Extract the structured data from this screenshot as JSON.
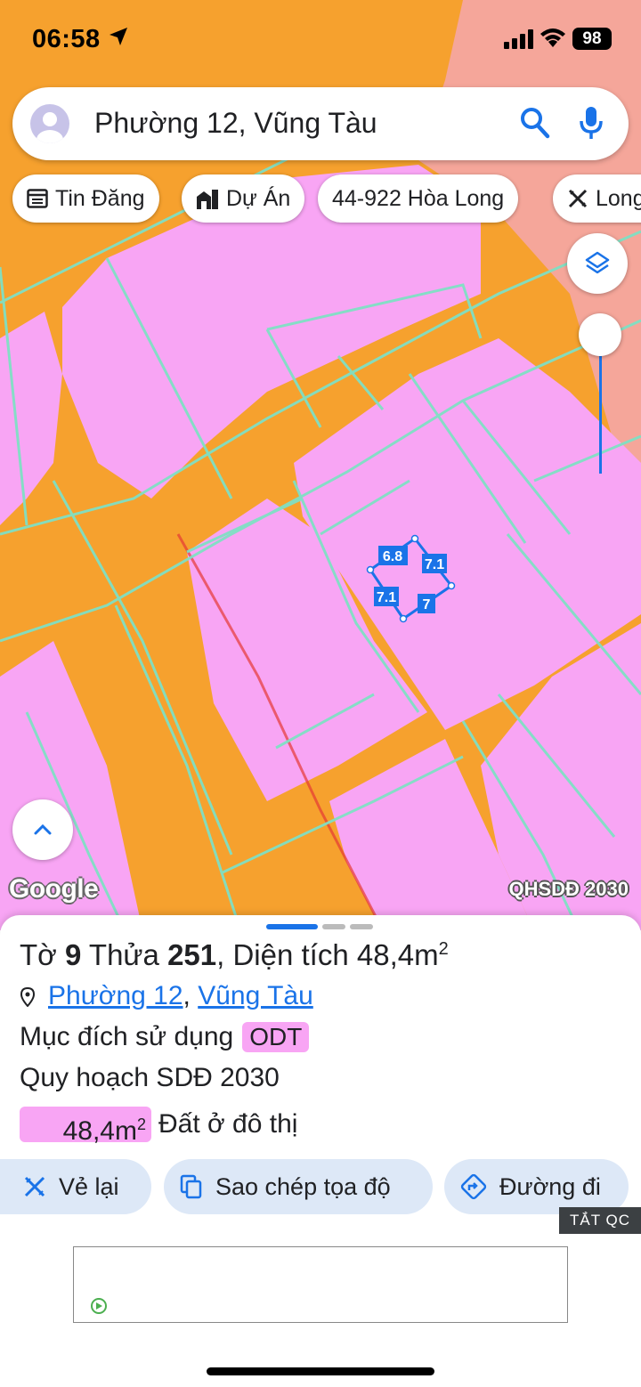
{
  "status": {
    "time": "06:58",
    "battery": "98"
  },
  "search": {
    "text": "Phường 12, Vũng Tàu"
  },
  "chips": [
    {
      "label": "Tin Đăng",
      "icon": "calendar-list-icon"
    },
    {
      "label": "Dự Án",
      "icon": "buildings-icon"
    },
    {
      "label": "44-922 Hòa Long",
      "icon": ""
    },
    {
      "label": "Long",
      "icon": "ruler-pencil-icon"
    }
  ],
  "map": {
    "logo": "Google",
    "layer_tag": "QHSDĐ 2030",
    "parcel_edges": [
      "6.8",
      "7.1",
      "7.1",
      "7"
    ],
    "colors": {
      "residential": "#f8a5f4",
      "road": "#f6a12e",
      "other": "#f5a69a",
      "boundary": "#7fe0c4",
      "parcel": "#1a73e8"
    }
  },
  "sheet": {
    "title_prefix": "Tờ",
    "sheet_no": "9",
    "plot_label": "Thửa",
    "plot_no": "251",
    "area_label": ", Diện tích",
    "area_value": "48,4m",
    "area_sup": "2",
    "ward_link": "Phường 12",
    "separator": ",",
    "city_link": "Vũng Tàu",
    "purpose_label": "Mục đích sử dụng",
    "purpose_code": "ODT",
    "plan_label": "Quy hoạch SDĐ 2030",
    "legend_area": "48,4m",
    "legend_sup": "2",
    "legend_label": "Đất ở đô thị"
  },
  "actions": {
    "redraw": "Vẻ lại",
    "copy_coords": "Sao chép tọa độ",
    "directions": "Đường đi"
  },
  "ad": {
    "tag": "TẮT QC"
  }
}
